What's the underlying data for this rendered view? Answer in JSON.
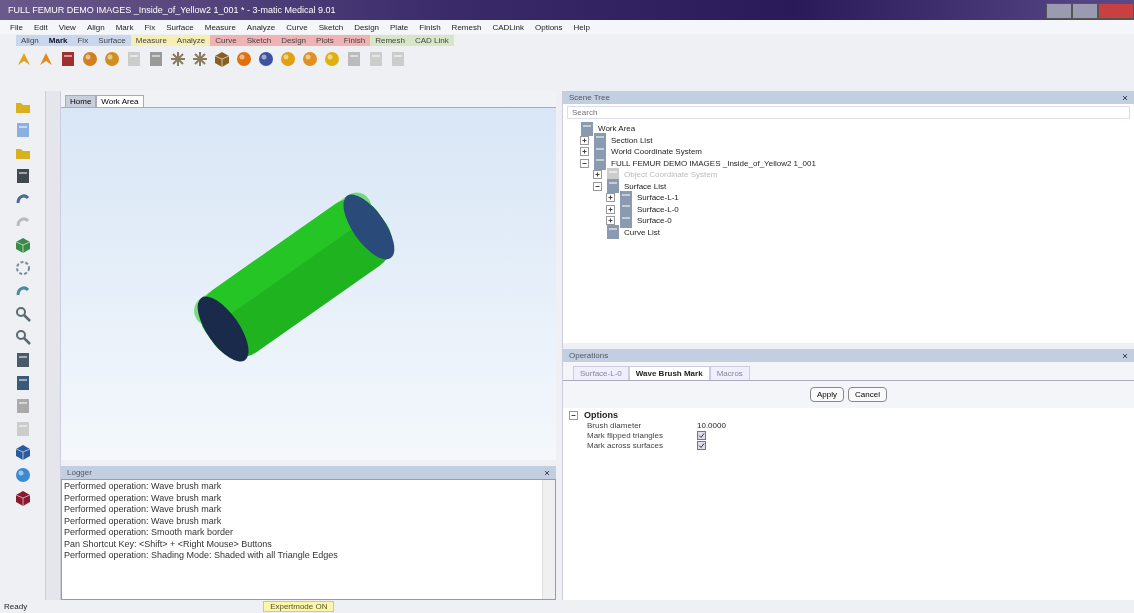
{
  "window": {
    "title": "FULL FEMUR DEMO IMAGES _Inside_of_Yellow2 1_001 * - 3-matic Medical 9.01"
  },
  "menu": [
    "File",
    "Edit",
    "View",
    "Align",
    "Mark",
    "Fix",
    "Surface",
    "Measure",
    "Analyze",
    "Curve",
    "Sketch",
    "Design",
    "Plate",
    "Finish",
    "Remesh",
    "CADLink",
    "Options",
    "Help"
  ],
  "ribbon_tabs": [
    {
      "label": "Align",
      "selected": false,
      "color": "#c9d7ee"
    },
    {
      "label": "Mark",
      "selected": true,
      "color": "#c9d7ee"
    },
    {
      "label": "Fix",
      "selected": false,
      "color": "#c9d7ee"
    },
    {
      "label": "Surface",
      "selected": false,
      "color": "#c9d7ee"
    },
    {
      "label": "Measure",
      "selected": false,
      "color": "#f6efb4"
    },
    {
      "label": "Analyze",
      "selected": false,
      "color": "#f6efb4"
    },
    {
      "label": "Curve",
      "selected": false,
      "color": "#efb3b3"
    },
    {
      "label": "Sketch",
      "selected": false,
      "color": "#efb3b3"
    },
    {
      "label": "Design",
      "selected": false,
      "color": "#efb3b3"
    },
    {
      "label": "Plots",
      "selected": false,
      "color": "#efb3b3"
    },
    {
      "label": "Finish",
      "selected": false,
      "color": "#efb3b3"
    },
    {
      "label": "Remesh",
      "selected": false,
      "color": "#d8e6c8"
    },
    {
      "label": "CAD Link",
      "selected": false,
      "color": "#d8e6c8"
    }
  ],
  "viewport": {
    "tabs": [
      {
        "label": "Home",
        "selected": true
      },
      {
        "label": "Work Area",
        "selected": false
      }
    ]
  },
  "logger": {
    "title": "Logger",
    "lines": [
      "Performed operation: Wave brush mark",
      "Performed operation: Wave brush mark",
      "Performed operation: Wave brush mark",
      "Performed operation: Wave brush mark",
      "Performed operation: Smooth mark border",
      "Pan Shortcut Key: <Shift> + <Right Mouse> Buttons",
      "Performed operation: Shading Mode: Shaded with all Triangle Edges"
    ]
  },
  "scene_tree": {
    "title": "Scene Tree",
    "search": {
      "placeholder": "Search"
    },
    "items": [
      {
        "label": "Work Area",
        "children": [
          {
            "label": "Section List",
            "expanded": false
          },
          {
            "label": "World Coordinate System",
            "expanded": false
          },
          {
            "label": "FULL FEMUR DEMO IMAGES _Inside_of_Yellow2 1_001",
            "expanded": true,
            "children": [
              {
                "label": "Object Coordinate System",
                "expanded": false,
                "disabled": true
              },
              {
                "label": "Surface List",
                "expanded": true,
                "children": [
                  {
                    "label": "Surface-L-1",
                    "expanded": false
                  },
                  {
                    "label": "Surface-L-0",
                    "expanded": false
                  },
                  {
                    "label": "Surface-0",
                    "expanded": false
                  }
                ]
              },
              {
                "label": "Curve List"
              }
            ]
          }
        ]
      }
    ]
  },
  "operations": {
    "title": "Operations",
    "tabs": [
      {
        "label": "Surface-L-0",
        "selected": false
      },
      {
        "label": "Wave Brush Mark",
        "selected": true
      },
      {
        "label": "Macros",
        "selected": false
      }
    ],
    "buttons": [
      "Apply",
      "Cancel"
    ],
    "section": {
      "label": "Options",
      "expanded": true
    },
    "options": [
      {
        "kind": "value",
        "label": "Brush diameter",
        "value": "10.0000"
      },
      {
        "kind": "checkbox",
        "label": "Mark flipped triangles",
        "checked": true
      },
      {
        "kind": "checkbox",
        "label": "Mark across surfaces",
        "checked": true
      }
    ]
  },
  "status_bar": {
    "status": "Ready",
    "mode": "Expertmode ON"
  }
}
